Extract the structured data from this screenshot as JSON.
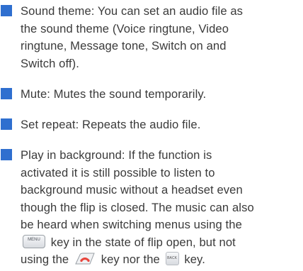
{
  "bullets": [
    {
      "lines": [
        "Sound theme: You can set an audio file as",
        "the sound theme (Voice ringtune, Video",
        "ringtune, Message tone, Switch on and",
        "Switch off)."
      ]
    },
    {
      "lines": [
        "Mute: Mutes the sound temporarily."
      ]
    },
    {
      "lines": [
        "Set repeat: Repeats the audio file."
      ]
    },
    {
      "lines": [
        "Play in background: If the function is",
        "activated it is still possible to listen to",
        "background music without a headset even",
        "though the flip is closed. The music can also",
        "be heard when switching menus using the"
      ],
      "line6_after_menu_key": "key in the state of flip open, but not",
      "line7_before_end_key": "using the",
      "line7_between_keys": "key nor the",
      "line7_after_back_key": "key."
    }
  ],
  "keys": {
    "menu_key_label": "MENU",
    "back_key_label": "BACK",
    "menu_key_icon": "menu-key-icon",
    "end_key_icon": "end-call-key-icon",
    "back_key_icon": "back-key-icon"
  },
  "colors": {
    "bullet": "#2f6fcf",
    "text": "#3a3a3a",
    "end_key": "#e8453c"
  }
}
